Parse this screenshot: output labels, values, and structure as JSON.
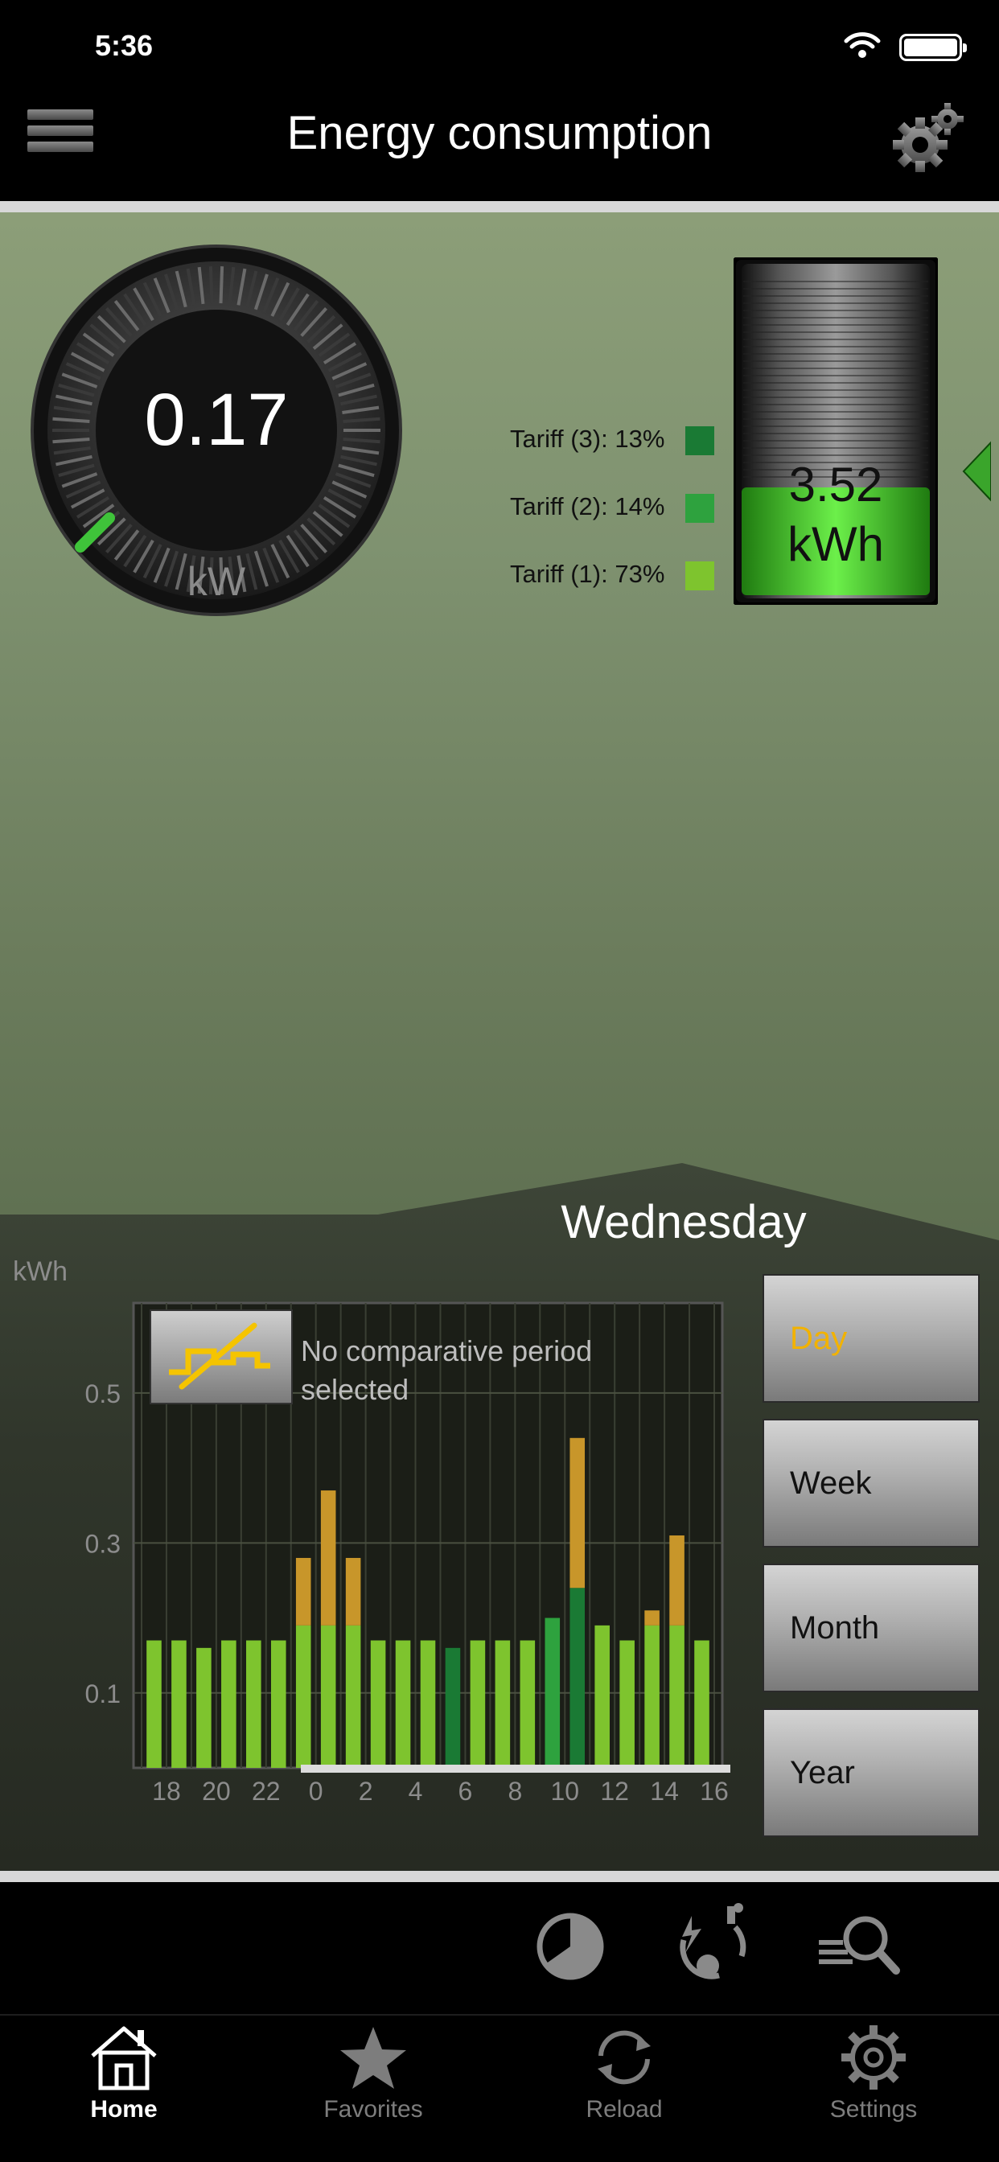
{
  "status_bar": {
    "time": "5:36"
  },
  "nav": {
    "title": "Energy consumption"
  },
  "gauge": {
    "value": "0.17",
    "unit": "kW"
  },
  "tariffs": [
    {
      "label": "Tariff (3): 13%",
      "color": "#1a7a34"
    },
    {
      "label": "Tariff (2): 14%",
      "color": "#2ea23e"
    },
    {
      "label": "Tariff (1): 73%",
      "color": "#7ec42e"
    }
  ],
  "tank": {
    "value": "3.52",
    "unit": "kWh"
  },
  "chart": {
    "day_title": "Wednesday",
    "unit_label": "kWh",
    "compare_text": "No comparative period selected"
  },
  "chart_data": {
    "type": "bar",
    "ylabel": "kWh",
    "y_ticks": [
      "0.5",
      "0.3",
      "0.1"
    ],
    "x_tick_labels": [
      "18",
      "20",
      "22",
      "0",
      "2",
      "4",
      "6",
      "8",
      "10",
      "12",
      "14",
      "16"
    ],
    "ylim": [
      0,
      0.62
    ],
    "grid": true,
    "series": [
      {
        "tariff": [
          1,
          1,
          1,
          1,
          1,
          1,
          1,
          1,
          1,
          1,
          1,
          1,
          3,
          1,
          1,
          1,
          2,
          3,
          1,
          1,
          1,
          1,
          1
        ],
        "values": [
          0.17,
          0.17,
          0.16,
          0.17,
          0.17,
          0.17,
          0.19,
          0.19,
          0.19,
          0.17,
          0.17,
          0.17,
          0.16,
          0.17,
          0.17,
          0.17,
          0.2,
          0.24,
          0.19,
          0.17,
          0.19,
          0.19,
          0.17
        ]
      },
      {
        "values": [
          0,
          0,
          0,
          0,
          0,
          0,
          0.09,
          0.18,
          0.09,
          0,
          0,
          0,
          0,
          0,
          0,
          0,
          0,
          0.2,
          0,
          0,
          0.02,
          0.12,
          0
        ]
      }
    ],
    "colors": {
      "tariff_1": "#7ec42e",
      "tariff_2": "#2ea23e",
      "tariff_3": "#1a7a34",
      "extra": "#c8962a"
    }
  },
  "periods": [
    {
      "label": "Day",
      "active": true
    },
    {
      "label": "Week",
      "active": false
    },
    {
      "label": "Month",
      "active": false
    },
    {
      "label": "Year",
      "active": false
    }
  ],
  "tabs": [
    {
      "label": "Home",
      "icon": "home-icon",
      "active": true
    },
    {
      "label": "Favorites",
      "icon": "star-icon",
      "active": false
    },
    {
      "label": "Reload",
      "icon": "reload-icon",
      "active": false
    },
    {
      "label": "Settings",
      "icon": "gear-icon",
      "active": false
    }
  ],
  "toolbar_icons": [
    "pie-chart-icon",
    "energy-source-icon",
    "analysis-search-icon"
  ]
}
